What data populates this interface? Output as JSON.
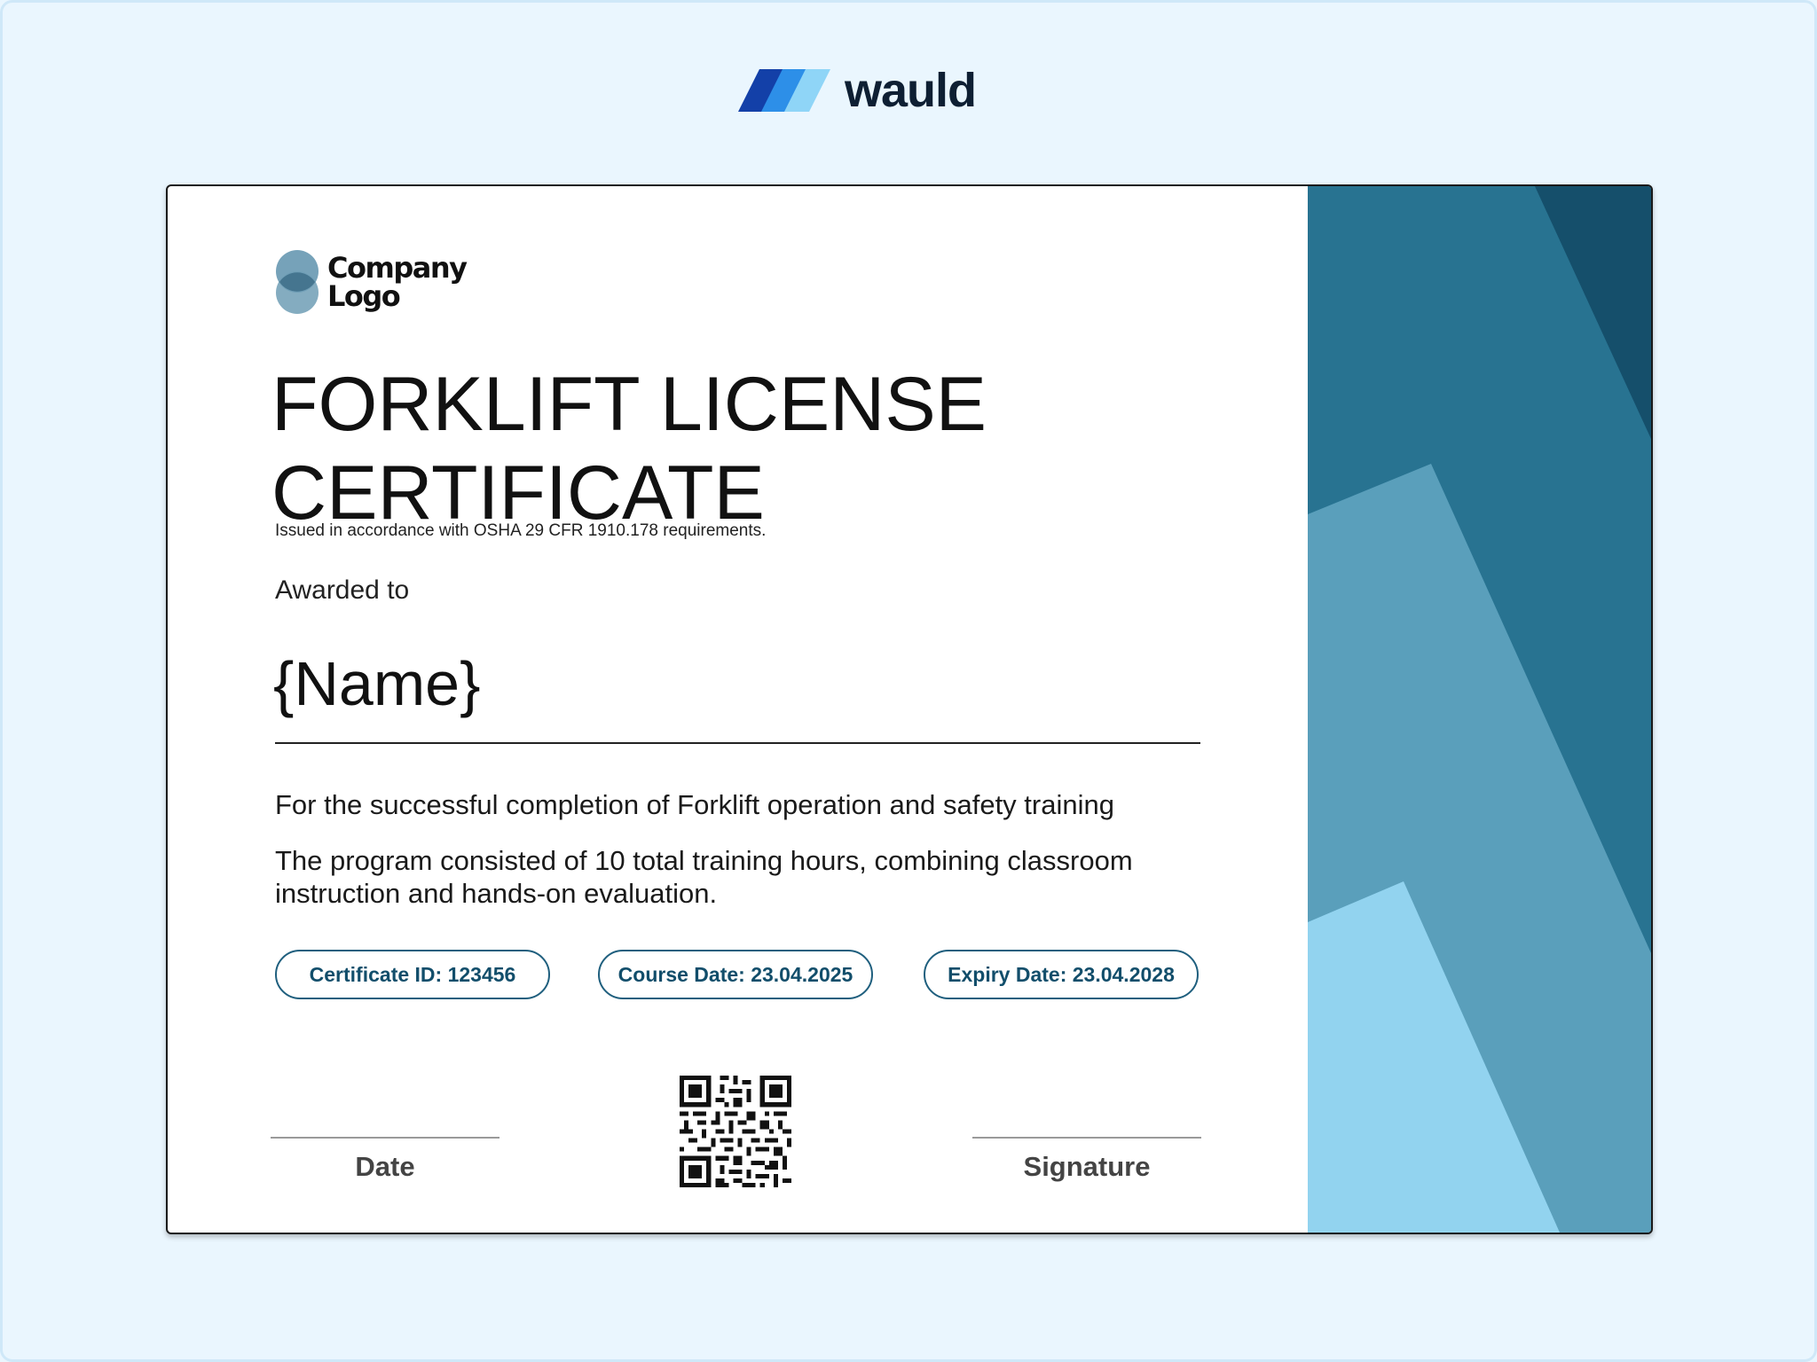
{
  "brand": {
    "name": "wauld"
  },
  "certificate": {
    "logo": {
      "line1": "Company",
      "line2": "Logo"
    },
    "title": "FORKLIFT LICENSE CERTIFICATE",
    "subtitle": "Issued in accordance with OSHA 29 CFR 1910.178 requirements.",
    "awarded_label": "Awarded to",
    "recipient_name": "{Name}",
    "completion_text": "For the successful completion of Forklift operation and safety training",
    "program_text": "The program consisted of 10 total training hours, combining classroom instruction and hands-on evaluation.",
    "badges": [
      {
        "text": "Certificate ID: 123456"
      },
      {
        "text": "Course Date: 23.04.2025"
      },
      {
        "text": "Expiry Date: 23.04.2028"
      }
    ],
    "date_label": "Date",
    "signature_label": "Signature"
  },
  "colors": {
    "page_background": "#eaf6fe",
    "accent_dark": "#124e6b",
    "panel_teal": "#287391",
    "panel_mid": "#5a9fbb",
    "panel_light": "#92d3ef",
    "panel_deep": "#154f6b"
  },
  "icons": {
    "brand_mark": "wauld-stripes-icon",
    "qr": "qr-code-icon",
    "logo_mark": "overlapping-circles-icon"
  }
}
